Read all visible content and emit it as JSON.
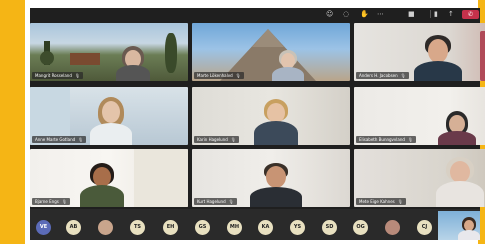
{
  "tiles": [
    {
      "name": "Mangrit Rosseland"
    },
    {
      "name": "Marte Lökenhalvd"
    },
    {
      "name": "Anders H. Jacobsen"
    },
    {
      "name": "Anne Marte Gotland"
    },
    {
      "name": "Karin Hagelund"
    },
    {
      "name": "Elisabeth Bunngvvland"
    },
    {
      "name": "Bjarne Engs"
    },
    {
      "name": "Kurt Hagelund"
    },
    {
      "name": "Mete Eige Kahnes"
    }
  ],
  "participants": [
    "VE",
    "AB",
    "",
    "TS",
    "EH",
    "GS",
    "MH",
    "KA",
    "YS",
    "SD",
    "OG",
    "",
    "CJ"
  ],
  "colors": {
    "app_bg": "#1f1f1f",
    "frame": "#f5b515",
    "end_call": "#c4314b",
    "avatar": "#e8e0c0"
  },
  "icons": [
    "video-icon",
    "mic-icon",
    "share-icon",
    "end-call-icon",
    "chat-icon",
    "people-icon",
    "more-icon"
  ]
}
